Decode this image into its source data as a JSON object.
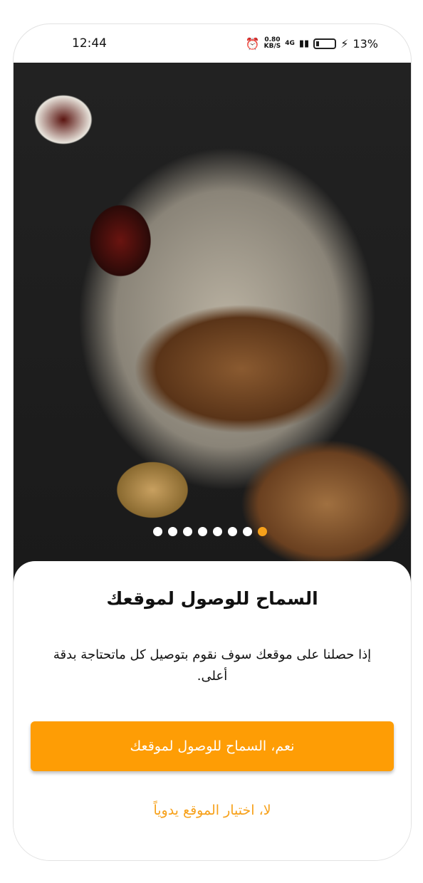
{
  "status_bar": {
    "time": "12:44",
    "speed": "0.80",
    "speed_unit": "KB/S",
    "network": "4G",
    "battery": "13%"
  },
  "carousel": {
    "total": 8,
    "active_index": 7,
    "colors": {
      "active": "#f7a11a",
      "inactive": "#ffffff"
    }
  },
  "sheet": {
    "title": "السماح للوصول لموقعك",
    "description": "إذا حصلنا على موقعك سوف نقوم بتوصيل كل ماتحتاجة بدقة أعلى.",
    "allow_button": "نعم، السماح للوصول لموقعك",
    "manual_link": "لا، اختيار الموقع يدوياً"
  },
  "colors": {
    "accent": "#fe9d05"
  }
}
